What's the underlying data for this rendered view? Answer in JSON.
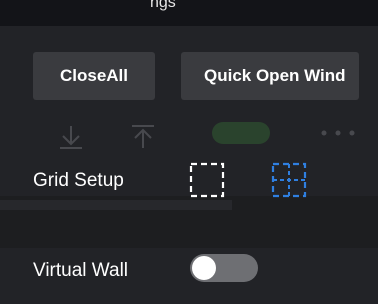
{
  "background_text": "ngs",
  "toolbar": {
    "close_all_label": "CloseAll",
    "quick_open_label": "Quick Open Wind"
  },
  "grid_setup": {
    "label": "Grid Setup",
    "selected_option": "split-grid"
  },
  "virtual_wall": {
    "label": "Virtual Wall",
    "enabled": false
  },
  "colors": {
    "panel": "#222327",
    "button": "#3a3b3f",
    "accent": "#2f7fe0",
    "toggle_off": "#6e6f73"
  }
}
